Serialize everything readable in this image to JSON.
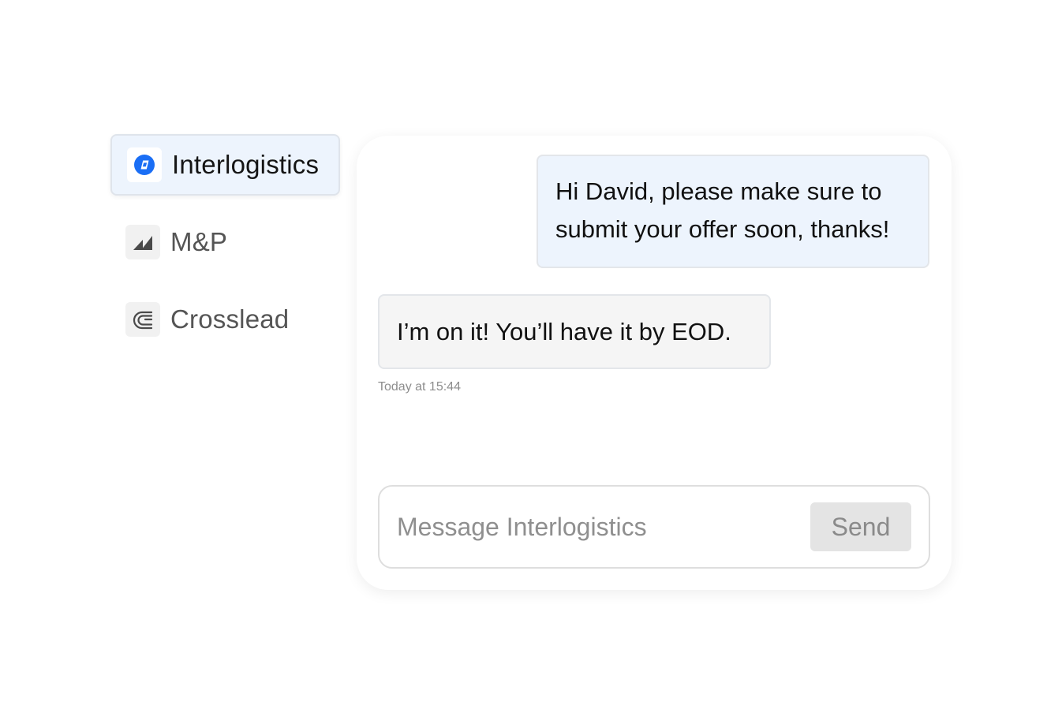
{
  "sidebar": {
    "items": [
      {
        "label": "Interlogistics",
        "icon": "interlogistics-logo-icon",
        "active": true
      },
      {
        "label": "M&P",
        "icon": "mp-logo-icon",
        "active": false
      },
      {
        "label": "Crosslead",
        "icon": "crosslead-logo-icon",
        "active": false
      }
    ]
  },
  "chat": {
    "messages": [
      {
        "direction": "sent",
        "lines": [
          "Hi David, please make sure to",
          "submit your offer soon, thanks!"
        ]
      },
      {
        "direction": "received",
        "lines": [
          "I’m on it! You’ll have it by EOD."
        ]
      }
    ],
    "timestamp": "Today at 15:44"
  },
  "composer": {
    "placeholder": "Message Interlogistics",
    "send_label": "Send"
  },
  "colors": {
    "accent_blue": "#1a6ef5",
    "active_bg": "#edf4fd",
    "received_bg": "#f5f5f5",
    "send_btn_bg": "#e4e4e4"
  }
}
